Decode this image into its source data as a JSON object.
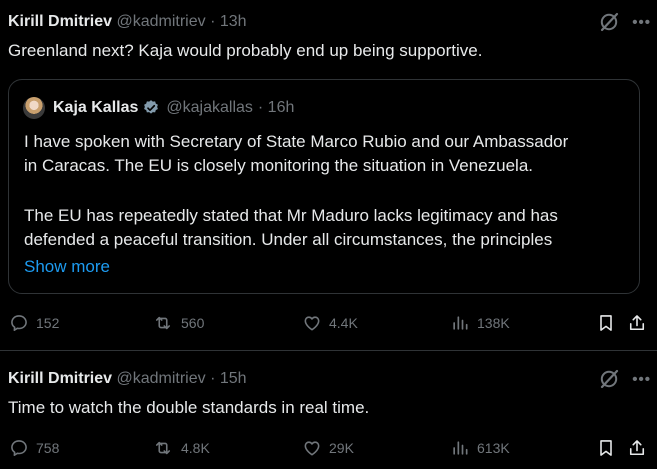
{
  "tweets": [
    {
      "author_name": "Kirill Dmitriev",
      "handle": "@kadmitriev",
      "time": "· 13h",
      "text": "Greenland next? Kaja would probably end up being supportive.",
      "quote": {
        "author_name": "Kaja Kallas",
        "handle": "@kajakallas",
        "time": "· 16h",
        "lines": [
          "I have spoken with Secretary of State Marco Rubio and our Ambassador",
          "in Caracas. The EU is closely monitoring the situation in Venezuela.",
          "The EU has repeatedly stated that Mr Maduro lacks legitimacy and has",
          "defended a peaceful transition. Under all circumstances, the principles"
        ],
        "show_more": "Show more"
      },
      "stats": {
        "replies": "152",
        "reposts": "560",
        "likes": "4.4K",
        "views": "138K"
      }
    },
    {
      "author_name": "Kirill Dmitriev",
      "handle": "@kadmitriev",
      "time": "· 15h",
      "text": "Time to watch the double standards in real time.",
      "stats": {
        "replies": "758",
        "reposts": "4.8K",
        "likes": "29K",
        "views": "613K"
      }
    }
  ],
  "icons": {
    "grok": "grok-slash-icon",
    "more": "more-horizontal-icon",
    "verified": "verified-badge-icon",
    "reply": "reply-bubble-icon",
    "repost": "repost-icon",
    "like": "heart-icon",
    "views": "views-bar-chart-icon",
    "bookmark": "bookmark-icon",
    "share": "share-icon"
  },
  "colors": {
    "background": "#000000",
    "text": "#e7e9ea",
    "muted": "#71767b",
    "link": "#1d9bf0",
    "border": "#2f3336",
    "verified": "#829aab"
  }
}
